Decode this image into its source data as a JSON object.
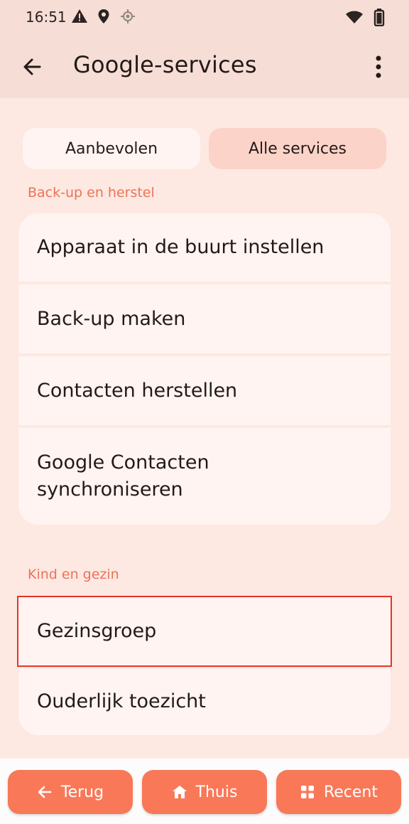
{
  "status_bar": {
    "time": "16:51",
    "icons_left": [
      "warning-icon",
      "location-pin-icon",
      "gps-target-icon"
    ],
    "icons_right": [
      "wifi-icon",
      "battery-icon"
    ]
  },
  "app_bar": {
    "title": "Google-services",
    "back_icon": "back-arrow-icon",
    "more_icon": "more-vert-icon"
  },
  "tabs": [
    {
      "label": "Aanbevolen",
      "selected": false
    },
    {
      "label": "Alle services",
      "selected": true
    }
  ],
  "sections": [
    {
      "header": "Back-up en herstel",
      "items": [
        {
          "label": "Apparaat in de buurt instellen"
        },
        {
          "label": "Back-up maken"
        },
        {
          "label": "Contacten herstellen"
        },
        {
          "label": "Google Contacten synchroniseren"
        }
      ]
    },
    {
      "header": "Kind en gezin",
      "items": [
        {
          "label": "Gezinsgroep",
          "highlighted": true
        },
        {
          "label": "Ouderlijk toezicht"
        }
      ]
    }
  ],
  "nav": {
    "back_label": "Terug",
    "home_label": "Thuis",
    "recent_label": "Recent"
  },
  "colors": {
    "accent": "#f97858",
    "section_header": "#ec7356",
    "highlight_border": "#e53525",
    "background": "#fde8e2",
    "card": "#fff4f1"
  }
}
